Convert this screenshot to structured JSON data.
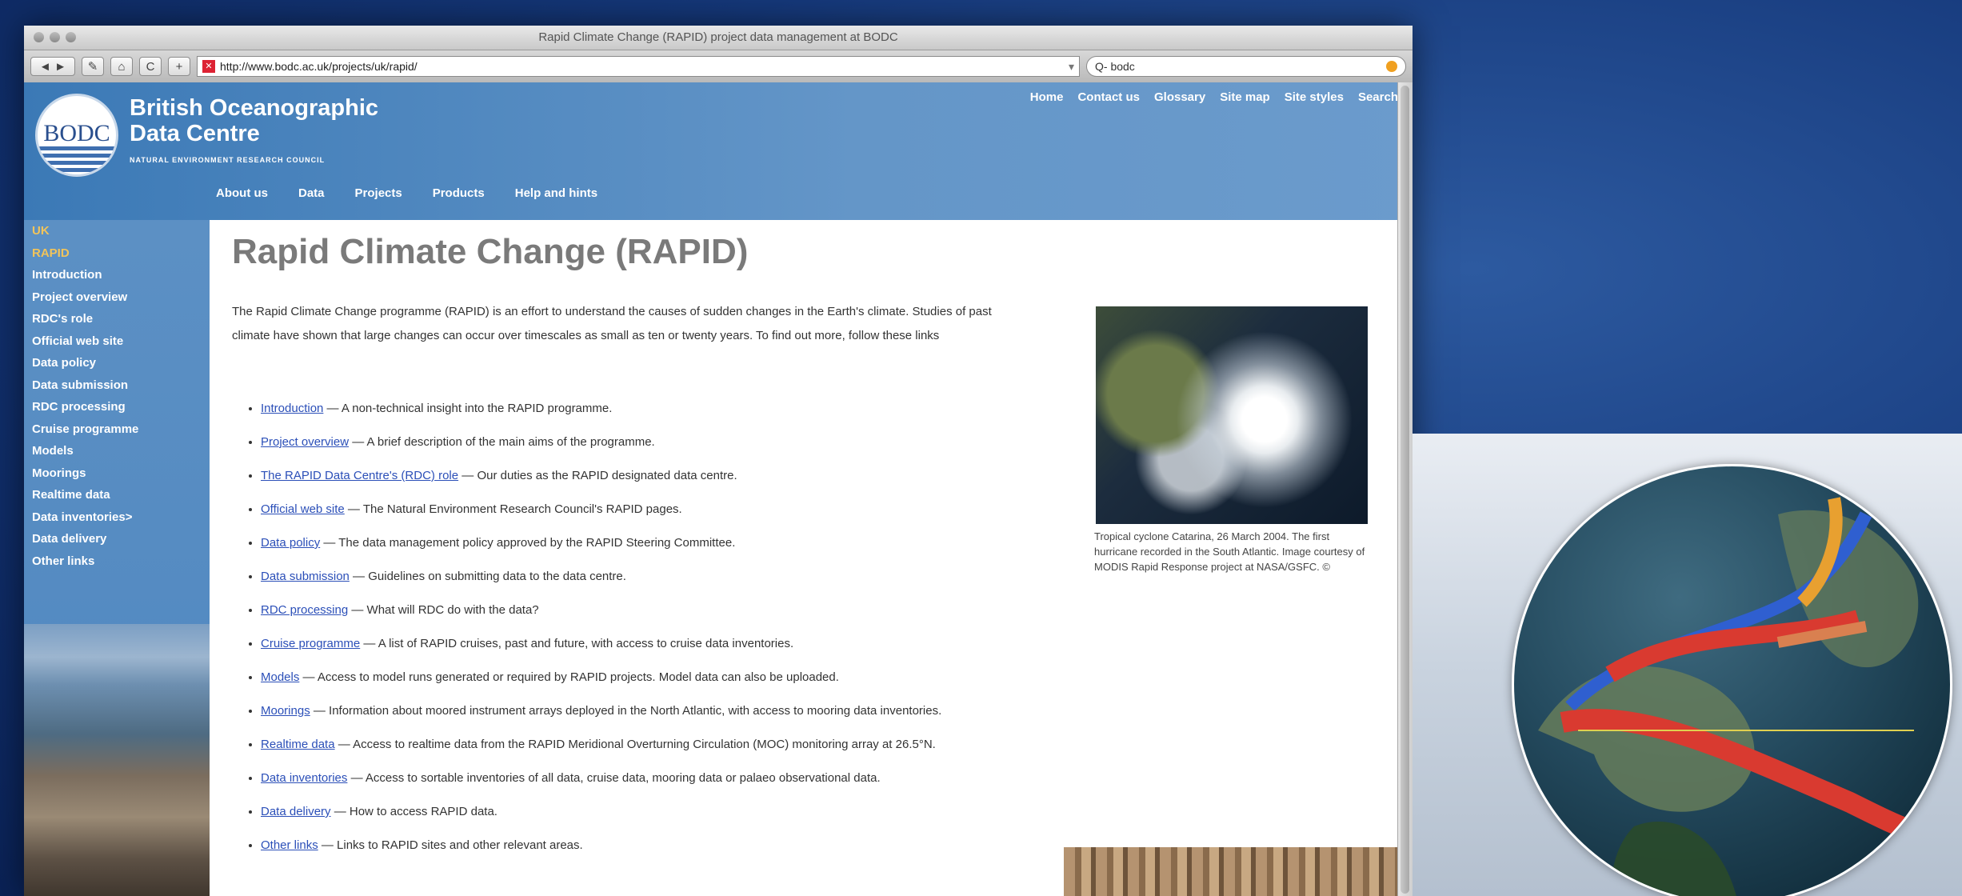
{
  "browser": {
    "title": "Rapid Climate Change (RAPID) project data management at BODC",
    "url": "http://www.bodc.ac.uk/projects/uk/rapid/",
    "search_value": "Q- bodc",
    "buttons": {
      "back": "◄",
      "forward": "►",
      "edit": "✎",
      "home": "⌂",
      "reload": "C",
      "add": "+"
    }
  },
  "site": {
    "logo_text": "BODC",
    "name_line1": "British Oceanographic",
    "name_line2": "Data Centre",
    "subtitle": "NATURAL ENVIRONMENT RESEARCH COUNCIL",
    "top_nav": [
      "Home",
      "Contact us",
      "Glossary",
      "Site map",
      "Site styles",
      "Search"
    ],
    "main_nav": [
      "About us",
      "Data",
      "Projects",
      "Products",
      "Help and hints"
    ]
  },
  "sidebar": {
    "items": [
      {
        "label": "UK",
        "highlight": true
      },
      {
        "label": "RAPID",
        "highlight": true
      },
      {
        "label": "Introduction",
        "highlight": false
      },
      {
        "label": "Project overview",
        "highlight": false
      },
      {
        "label": "RDC's role",
        "highlight": false
      },
      {
        "label": "Official web site",
        "highlight": false
      },
      {
        "label": "Data policy",
        "highlight": false
      },
      {
        "label": "Data submission",
        "highlight": false
      },
      {
        "label": "RDC processing",
        "highlight": false
      },
      {
        "label": "Cruise programme",
        "highlight": false
      },
      {
        "label": "Models",
        "highlight": false
      },
      {
        "label": "Moorings",
        "highlight": false
      },
      {
        "label": "Realtime data",
        "highlight": false
      },
      {
        "label": "Data inventories>",
        "highlight": false
      },
      {
        "label": "Data delivery",
        "highlight": false
      },
      {
        "label": "Other links",
        "highlight": false
      }
    ]
  },
  "content": {
    "heading": "Rapid Climate Change (RAPID)",
    "intro": "The Rapid Climate Change programme (RAPID) is an effort to understand the causes of sudden changes in the Earth's climate. Studies of past climate have shown that large changes can occur over timescales as small as ten or twenty years. To find out more, follow these links",
    "links": [
      {
        "link": "Introduction",
        "desc": " — A non-technical insight into the RAPID programme."
      },
      {
        "link": "Project overview",
        "desc": " — A brief description of the main aims of the programme."
      },
      {
        "link": "The RAPID Data Centre's (RDC) role",
        "desc": " — Our duties as the RAPID designated data centre."
      },
      {
        "link": "Official web site",
        "desc": " — The Natural Environment Research Council's RAPID pages."
      },
      {
        "link": "Data policy",
        "desc": " — The data management policy approved by the RAPID Steering Committee."
      },
      {
        "link": "Data submission",
        "desc": " — Guidelines on submitting data to the data centre."
      },
      {
        "link": "RDC processing",
        "desc": " — What will RDC do with the data?"
      },
      {
        "link": "Cruise programme",
        "desc": " — A list of RAPID cruises, past and future, with access to cruise data inventories."
      },
      {
        "link": "Models",
        "desc": " — Access to model runs generated or required by RAPID projects. Model data can also be uploaded."
      },
      {
        "link": "Moorings",
        "desc": " — Information about moored instrument arrays deployed in the North Atlantic, with access to mooring data inventories."
      },
      {
        "link": "Realtime data",
        "desc": " — Access to realtime data from the RAPID Meridional Overturning Circulation (MOC) monitoring array at 26.5°N."
      },
      {
        "link": "Data inventories",
        "desc": " — Access to sortable inventories of all data, cruise data, mooring data or palaeo observational data."
      },
      {
        "link": "Data delivery",
        "desc": " — How to access RAPID data."
      },
      {
        "link": "Other links",
        "desc": " — Links to RAPID sites and other relevant areas."
      }
    ],
    "caption": "Tropical cyclone Catarina, 26 March 2004. The first hurricane recorded in the South Atlantic. Image courtesy of MODIS Rapid Response project at NASA/GSFC. ©"
  },
  "colors": {
    "header_blue": "#5c90c4",
    "nav_highlight": "#f2c45a",
    "link_blue": "#2b4fb8",
    "desktop_blue": "#15387a"
  }
}
